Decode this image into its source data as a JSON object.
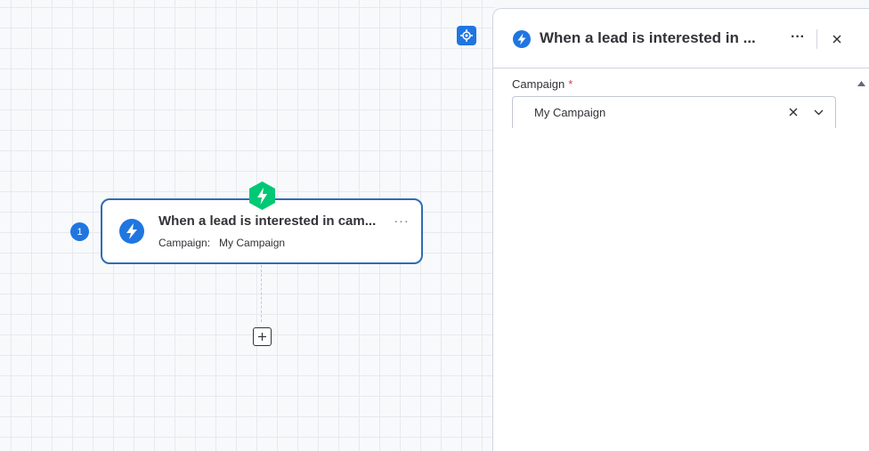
{
  "canvas": {
    "step_number": "1",
    "node": {
      "title": "When a lead is interested in cam...",
      "campaign_label": "Campaign:",
      "campaign_value": "My Campaign",
      "menu_label": "···"
    }
  },
  "panel": {
    "title": "When a lead is interested in ...",
    "more_label": "···",
    "field": {
      "label": "Campaign",
      "required_mark": "*",
      "value": "My Campaign"
    }
  },
  "icons": {
    "focus": "crosshair-icon",
    "trigger": "lightning-hexagon-icon",
    "node": "lightning-circle-icon",
    "add": "plus-icon",
    "close": "close-icon",
    "clear": "clear-icon",
    "chevron": "chevron-down-icon",
    "scroll": "scroll-up-icon"
  },
  "colors": {
    "accent_blue": "#1f76e0",
    "node_border": "#2d6db5",
    "trigger_green": "#00c875",
    "required_red": "#d83a52"
  }
}
